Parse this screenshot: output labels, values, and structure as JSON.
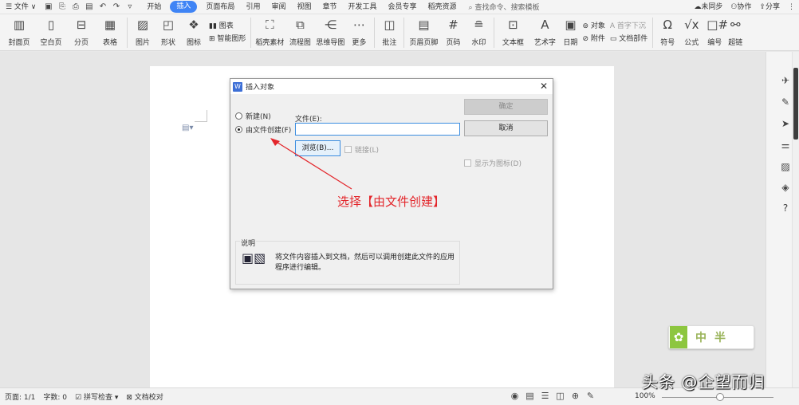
{
  "menubar": {
    "file_label": "☰ 文件 ∨",
    "tabs": [
      "开始",
      "插入",
      "页面布局",
      "引用",
      "审阅",
      "视图",
      "章节",
      "开发工具",
      "会员专享",
      "稻壳资源"
    ],
    "active_tab": "插入",
    "search_placeholder": "查找命令、搜索模板",
    "sync": "未同步",
    "collab": "协作",
    "share": "分享"
  },
  "ribbon": {
    "cover": "封面页",
    "blank": "空白页",
    "pagebreak": "分页",
    "table": "表格",
    "picture": "图片",
    "shape": "形状",
    "icon": "图标",
    "chart": "图表",
    "smartart": "智能图形",
    "docer": "稻壳素材",
    "flow": "流程图",
    "mindmap": "思维导图",
    "more": "更多",
    "comment": "批注",
    "header_footer": "页眉页脚",
    "page_num": "页码",
    "watermark": "水印",
    "textbox": "文本框",
    "wordart": "艺术字",
    "date": "日期",
    "object": "对象",
    "dropcap": "首字下沉",
    "attachment": "附件",
    "docpart": "文档部件",
    "symbol": "符号",
    "formula": "公式",
    "number": "编号",
    "hyperlink": "超链"
  },
  "dialog": {
    "title": "插入对象",
    "radio_new": "新建(N)",
    "radio_from_file": "由文件创建(F)",
    "file_label": "文件(E):",
    "file_value": "",
    "ok": "确定",
    "cancel": "取消",
    "browse": "浏览(B)...",
    "link": "链接(L)",
    "show_as_icon": "显示为图标(D)",
    "desc_label": "说明",
    "desc_text": "将文件内容插入到文档，然后可以调用创建此文件的应用程序进行编辑。",
    "annotation": "选择【由文件创建】"
  },
  "statusbar": {
    "page": "页面: 1/1",
    "words": "字数: 0",
    "spell": "拼写检查",
    "proof": "文档校对",
    "zoom": "100%"
  },
  "badge_text": "中半",
  "watermark_text": "头条 @企望而归",
  "colors": {
    "accent": "#3f84f5",
    "annotation": "#e3262b",
    "badge": "#8dc63f"
  }
}
